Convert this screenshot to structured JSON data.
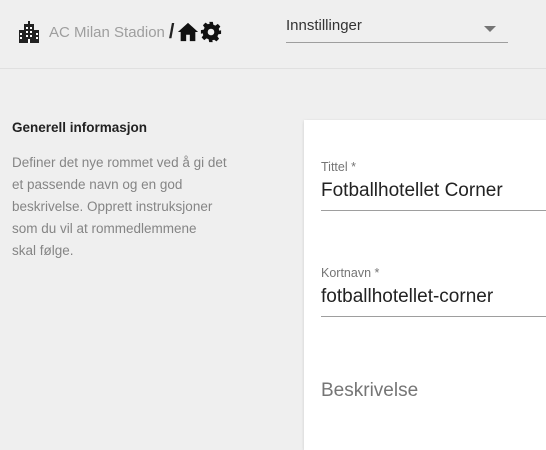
{
  "header": {
    "org_name": "AC Milan Stadion",
    "separator": "/",
    "page_select": {
      "value": "Innstillinger"
    },
    "icons": [
      "building-icon",
      "home-icon",
      "gear-icon",
      "chevron-down-icon"
    ]
  },
  "info": {
    "heading": "Generell informasjon",
    "lines": [
      "Definer det nye rommet ved å gi det",
      "et passende navn og en god",
      "beskrivelse. Opprett instruksjoner",
      "som du vil at rommedlemmene",
      "skal følge."
    ]
  },
  "form": {
    "title_label": "Tittel *",
    "title_value": "Fotballhotellet Corner",
    "shortname_label": "Kortnavn *",
    "shortname_value": "fotballhotellet-corner",
    "description_label": "Beskrivelse"
  }
}
